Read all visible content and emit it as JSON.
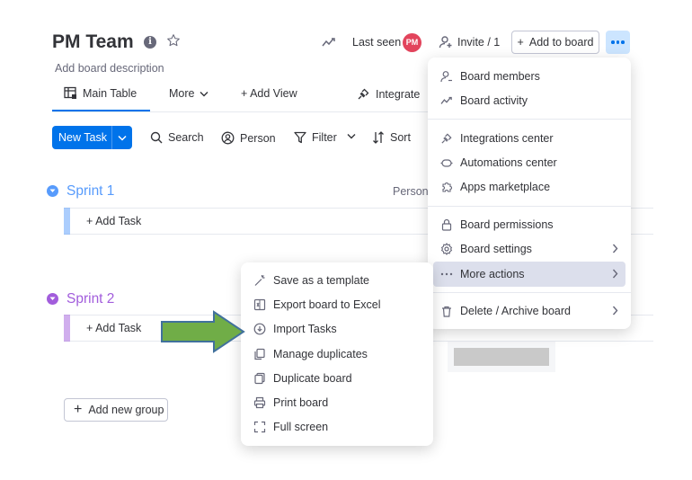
{
  "board": {
    "title": "PM Team",
    "info_glyph": "i",
    "description": "Add board description"
  },
  "header": {
    "last_seen": "Last seen",
    "avatar_initials": "PM",
    "invite": "Invite / 1",
    "add_to_board": "Add to board"
  },
  "tabs": {
    "main_table": "Main Table",
    "more": "More",
    "add_view": "+ Add View",
    "integrate": "Integrate"
  },
  "toolbar": {
    "new_task": "New Task",
    "search": "Search",
    "person": "Person",
    "filter": "Filter",
    "sort": "Sort"
  },
  "groups": [
    {
      "title": "Sprint 1",
      "add_task": "+ Add Task",
      "color": "#579bfc"
    },
    {
      "title": "Sprint 2",
      "add_task": "+ Add Task",
      "color": "#a25ddc"
    }
  ],
  "columns": {
    "person": "Person"
  },
  "add_group": "Add new group",
  "main_menu": {
    "items": [
      {
        "label": "Board members",
        "icon": "person-icon"
      },
      {
        "label": "Board activity",
        "icon": "activity-icon"
      },
      {
        "label": "Integrations center",
        "icon": "plug-icon"
      },
      {
        "label": "Automations center",
        "icon": "robot-icon"
      },
      {
        "label": "Apps marketplace",
        "icon": "puzzle-icon"
      },
      {
        "label": "Board permissions",
        "icon": "lock-icon"
      },
      {
        "label": "Board settings",
        "icon": "gear-icon"
      },
      {
        "label": "More actions",
        "icon": "dots-icon"
      },
      {
        "label": "Delete / Archive board",
        "icon": "trash-icon"
      }
    ]
  },
  "sub_menu": {
    "items": [
      {
        "label": "Save as a template",
        "icon": "wand-icon"
      },
      {
        "label": "Export board to Excel",
        "icon": "excel-icon"
      },
      {
        "label": "Import Tasks",
        "icon": "download-icon"
      },
      {
        "label": "Manage duplicates",
        "icon": "duplicates-icon"
      },
      {
        "label": "Duplicate board",
        "icon": "copy-icon"
      },
      {
        "label": "Print board",
        "icon": "printer-icon"
      },
      {
        "label": "Full screen",
        "icon": "fullscreen-icon"
      }
    ]
  },
  "colors": {
    "primary": "#0073ea",
    "highlight": "#dcdfec",
    "arrow_fill": "#70ad47",
    "arrow_stroke": "#41719c"
  }
}
